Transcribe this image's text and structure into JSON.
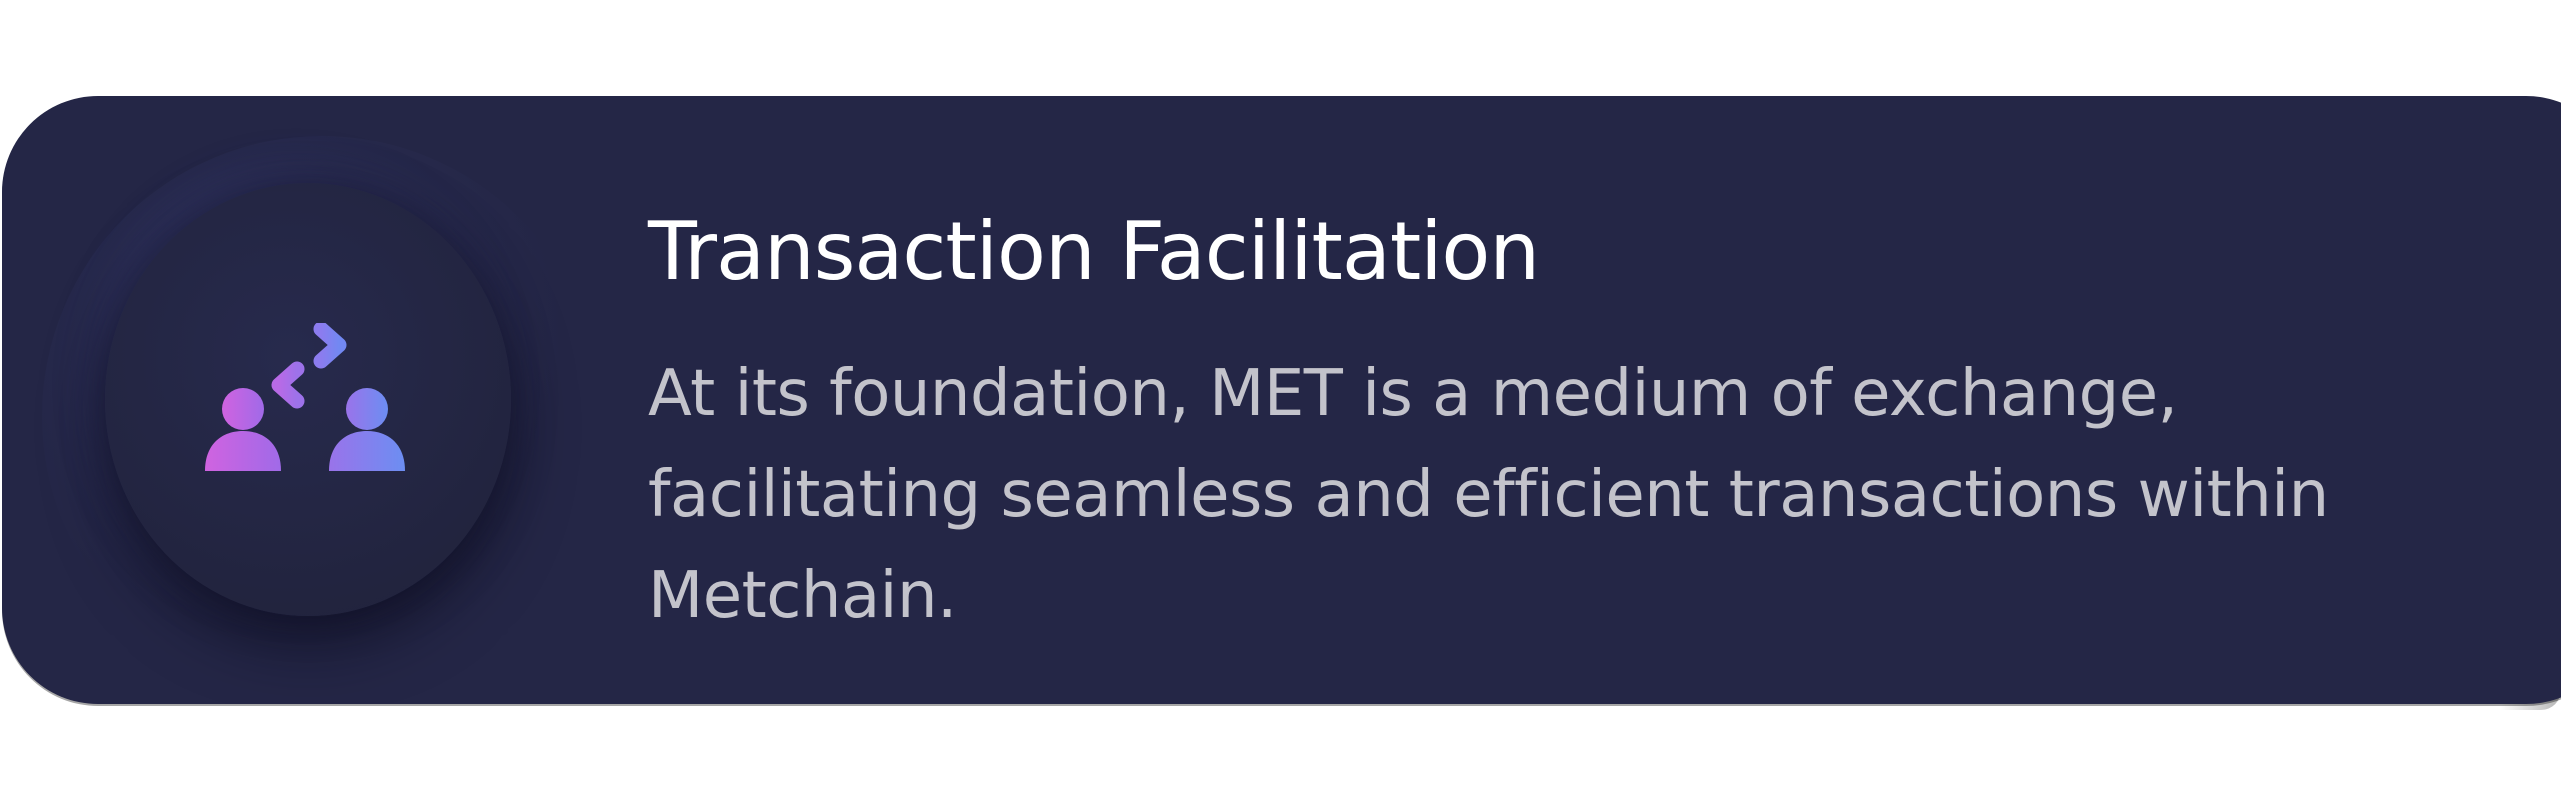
{
  "card": {
    "title": "Transaction Facilitation",
    "description": "At its foundation, MET is a medium of exchange, facilitating seamless and efficient transactions within Metchain.",
    "icon": "user-exchange-icon"
  },
  "colors": {
    "page_background": "#ffffff",
    "card_background": "#242646",
    "title_text": "#ffffff",
    "description_text": "#c3c3cb",
    "icon_gradient_start": "#c65ee0",
    "icon_gradient_end": "#6f8cf2"
  }
}
